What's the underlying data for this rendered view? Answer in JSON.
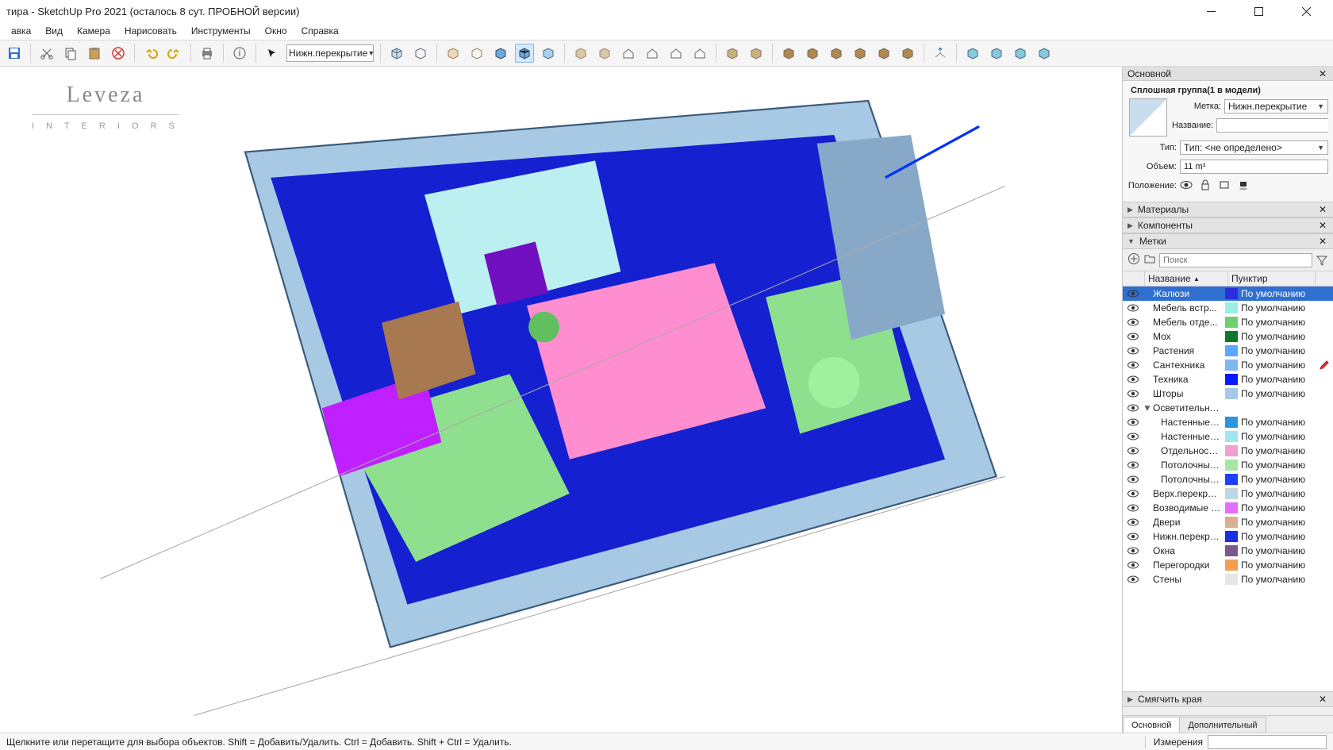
{
  "window": {
    "title": "тира - SketchUp Pro 2021 (осталось 8 сут. ПРОБНОЙ версии)"
  },
  "menus": [
    "авка",
    "Вид",
    "Камера",
    "Нарисовать",
    "Инструменты",
    "Окно",
    "Справка"
  ],
  "toolbar": {
    "active_layer": "Нижн.перекрытие"
  },
  "logo": {
    "line1": "Leveza",
    "line2": "I N T E R I O R S"
  },
  "tray": {
    "title": "Основной",
    "entity": {
      "heading": "Сплошная группа(1 в модели)",
      "label_metka": "Метка:",
      "metka_value": "Нижн.перекрытие",
      "label_name": "Название:",
      "name_value": "",
      "label_type": "Тип:",
      "type_value": "Тип: <не определено>",
      "label_volume": "Объем:",
      "volume_value": "11 m³",
      "label_pos": "Положение:"
    },
    "sections": {
      "materials": "Материалы",
      "components": "Компоненты",
      "tags": "Метки",
      "soften": "Смягчить края"
    },
    "tags_search_placeholder": "Поиск",
    "tags_cols": {
      "name": "Название",
      "dash": "Пунктир"
    },
    "default_dash": "По умолчанию",
    "tags": [
      {
        "name": "Жалюзи",
        "color": "#2a2fdc",
        "dash": "По умолчанию",
        "selected": true,
        "indent": 0,
        "expander": ""
      },
      {
        "name": "Мебель встр...",
        "color": "#9fece0",
        "dash": "По умолчанию",
        "selected": false,
        "indent": 0,
        "expander": ""
      },
      {
        "name": "Мебель отде...",
        "color": "#6fcf6f",
        "dash": "По умолчанию",
        "selected": false,
        "indent": 0,
        "expander": ""
      },
      {
        "name": "Мох",
        "color": "#0a7a2a",
        "dash": "По умолчанию",
        "selected": false,
        "indent": 0,
        "expander": ""
      },
      {
        "name": "Растения",
        "color": "#5aa8ff",
        "dash": "По умолчанию",
        "selected": false,
        "indent": 0,
        "expander": ""
      },
      {
        "name": "Сантехника",
        "color": "#7fb7f2",
        "dash": "По умолчанию",
        "selected": false,
        "indent": 0,
        "expander": "",
        "pencil": true
      },
      {
        "name": "Техника",
        "color": "#0a18ff",
        "dash": "По умолчанию",
        "selected": false,
        "indent": 0,
        "expander": ""
      },
      {
        "name": "Шторы",
        "color": "#a8c8e8",
        "dash": "По умолчанию",
        "selected": false,
        "indent": 0,
        "expander": ""
      },
      {
        "name": "Осветительные приборы",
        "color": "",
        "dash": "",
        "selected": false,
        "indent": 0,
        "expander": "▼"
      },
      {
        "name": "Настенные в...",
        "color": "#2a96e0",
        "dash": "По умолчанию",
        "selected": false,
        "indent": 1,
        "expander": ""
      },
      {
        "name": "Настенные н...",
        "color": "#9fe6f2",
        "dash": "По умолчанию",
        "selected": false,
        "indent": 1,
        "expander": ""
      },
      {
        "name": "Отдельносто...",
        "color": "#f29fd2",
        "dash": "По умолчанию",
        "selected": false,
        "indent": 1,
        "expander": ""
      },
      {
        "name": "Потолочные ...",
        "color": "#a8e6a0",
        "dash": "По умолчанию",
        "selected": false,
        "indent": 1,
        "expander": ""
      },
      {
        "name": "Потолочные ...",
        "color": "#1a3fff",
        "dash": "По умолчанию",
        "selected": false,
        "indent": 1,
        "expander": ""
      },
      {
        "name": "Верх.перекрытие",
        "color": "#c0d6e4",
        "dash": "По умолчанию",
        "selected": false,
        "indent": 0,
        "expander": ""
      },
      {
        "name": "Возводимые кон...",
        "color": "#e46fff",
        "dash": "По умолчанию",
        "selected": false,
        "indent": 0,
        "expander": ""
      },
      {
        "name": "Двери",
        "color": "#d6b090",
        "dash": "По умолчанию",
        "selected": false,
        "indent": 0,
        "expander": ""
      },
      {
        "name": "Нижн.перекрытие",
        "color": "#1a2fe0",
        "dash": "По умолчанию",
        "selected": false,
        "indent": 0,
        "expander": ""
      },
      {
        "name": "Окна",
        "color": "#7a5a8a",
        "dash": "По умолчанию",
        "selected": false,
        "indent": 0,
        "expander": ""
      },
      {
        "name": "Перегородки",
        "color": "#f2a050",
        "dash": "По умолчанию",
        "selected": false,
        "indent": 0,
        "expander": ""
      },
      {
        "name": "Стены",
        "color": "#e6e6e6",
        "dash": "По умолчанию",
        "selected": false,
        "indent": 0,
        "expander": ""
      }
    ],
    "bottom_tabs": [
      "Основной",
      "Дополнительный"
    ],
    "active_tab": 0
  },
  "status": {
    "msg": "Щелкните или перетащите для выбора объектов. Shift = Добавить/Удалить. Ctrl = Добавить. Shift + Ctrl = Удалить.",
    "measure_label": "Измерения"
  }
}
